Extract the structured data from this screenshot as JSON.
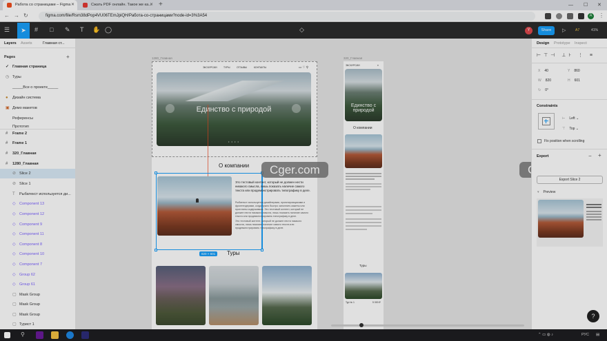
{
  "browser": {
    "tabs": [
      {
        "label": "Работа со страницами – Figma",
        "fav_color": "#f24e1e"
      },
      {
        "label": "Сжать PDF онлайн. Такое же ка...",
        "fav_color": "#e53935"
      }
    ],
    "url": "figma.com/file/Rsm38dPop4VU06TEmJpiQH/Работа-со-страницами?node-id=3%3A54",
    "user_initial": "A"
  },
  "figma": {
    "avatar_initial": "Y",
    "share_label": "Share",
    "zoom_label": "41%",
    "user_label": "A7"
  },
  "left": {
    "tabs": [
      "Layers",
      "Assets",
      "Главная ст..."
    ],
    "pages_title": "Pages",
    "pages": [
      "Главная страница",
      "Туры",
      "_____Все о проекте_____",
      "Дизайн система",
      "Демо макетов",
      "Референсы",
      "Прототип"
    ],
    "layers": [
      {
        "label": "Frame 2",
        "kind": "frame"
      },
      {
        "label": "Frame 1",
        "kind": "frame"
      },
      {
        "label": "320_Главная",
        "kind": "frame"
      },
      {
        "label": "1280_Главная",
        "kind": "frame"
      },
      {
        "label": "Slice 2",
        "kind": "slice"
      },
      {
        "label": "Slice 1",
        "kind": "slice"
      },
      {
        "label": "Рыбатекст используется ди...",
        "kind": "text"
      },
      {
        "label": "Component 13",
        "kind": "component"
      },
      {
        "label": "Component 12",
        "kind": "component"
      },
      {
        "label": "Component 9",
        "kind": "component"
      },
      {
        "label": "Component 11",
        "kind": "component"
      },
      {
        "label": "Component 8",
        "kind": "component"
      },
      {
        "label": "Component 10",
        "kind": "component"
      },
      {
        "label": "Component 7",
        "kind": "component"
      },
      {
        "label": "Group 62",
        "kind": "component"
      },
      {
        "label": "Group 61",
        "kind": "component"
      },
      {
        "label": "Mask Group",
        "kind": "group"
      },
      {
        "label": "Mask Group",
        "kind": "group"
      },
      {
        "label": "Mask Group",
        "kind": "group"
      },
      {
        "label": "Турист 1",
        "kind": "group"
      }
    ]
  },
  "canvas": {
    "frame_desktop_label": "1280_Главная",
    "frame_mobile_label": "320_Главная",
    "nav_links": [
      "ЭКСКУРСИИ",
      "ТУРЫ",
      "ОТЗЫВЫ",
      "КОНТАКТЫ"
    ],
    "logo": "ЭКСКУРСИИ",
    "hero_title": "Единство с природой",
    "about_title": "О компании",
    "about_lead": "Это тестовый контент, который не должен нести никакого смысла, лишь показать наличие самого текста или продемонстрировать типографику в деле.",
    "about_p1": "Рыбатекст используется дизайнерами, проектировщиками и фронтендерами, когда нужно быстро заполнить макеты или прототипы содержимым. Это тестовый контент, который не должен нести никакого смысла, лишь показать наличие самого текста или продемонстрировать типографику в деле.",
    "about_p2": "Это тестовый контент, который не должен нести никакого смысла, лишь показать наличие самого текста или продемонстрировать типографику в деле.",
    "size_badge": "820 × 601",
    "tours_title": "Туры",
    "mobile_logo": "ЭКСКУРСИИ",
    "mobile_hero_title": "Единство с природой",
    "mobile_about_title": "О компании",
    "mobile_tours_title": "Туры",
    "mobile_card_label": "Тур № 1",
    "mobile_card_price": "5 000 ₽",
    "watermark": "Cger.com"
  },
  "right": {
    "tabs": [
      "Design",
      "Prototype",
      "Inspect"
    ],
    "x": "40",
    "y": "860",
    "w": "820",
    "h": "601",
    "rot": "0°",
    "constraints_title": "Constraints",
    "constraint_h": "Left",
    "constraint_v": "Top",
    "fix_scroll": "Fix position when scrolling",
    "export_title": "Export",
    "export_button": "Export Slice 2",
    "preview_label": "Preview"
  },
  "taskbar": {
    "lang": "РУС"
  },
  "colors": {
    "figma_blue": "#18a0fb",
    "component_purple": "#7b61ff",
    "toolbar_bg": "#2c2c2c"
  }
}
